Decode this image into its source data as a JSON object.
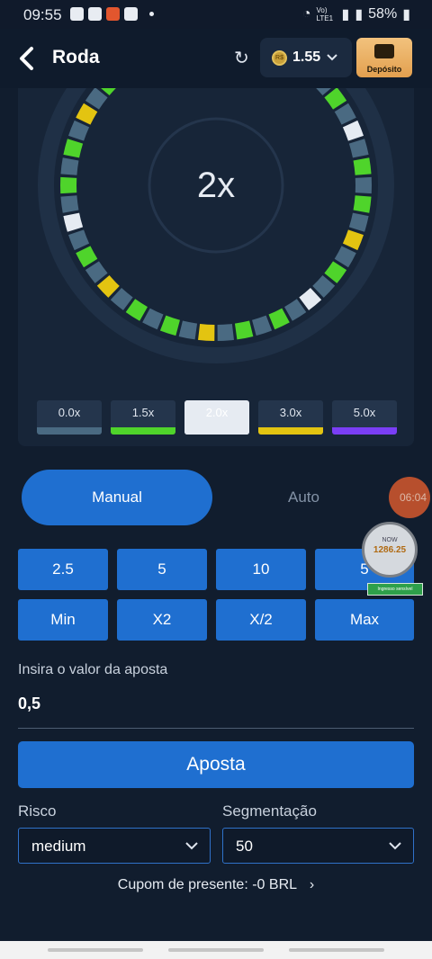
{
  "status_bar": {
    "time": "09:55",
    "battery": "58%",
    "network": "Vo) LTE1"
  },
  "header": {
    "title": "Roda",
    "balance": "1.55",
    "coin_symbol": "R$",
    "deposit_label": "Depósito"
  },
  "wheel": {
    "multiplier": "2x",
    "legend": [
      {
        "label": "0.0x",
        "color": "#4a6a82"
      },
      {
        "label": "1.5x",
        "color": "#4fd42b"
      },
      {
        "label": "2.0x",
        "color": "#e6ebf2"
      },
      {
        "label": "3.0x",
        "color": "#e3c411"
      },
      {
        "label": "5.0x",
        "color": "#7a3ef5"
      }
    ],
    "selected_legend": "2.0x"
  },
  "mode_tabs": {
    "manual": "Manual",
    "auto": "Auto",
    "active": "Manual"
  },
  "overlay": {
    "timer": "06:04",
    "widget_label": "NOW",
    "widget_value": "1286.25",
    "widget_bar": "Ingresso sensível"
  },
  "quick_bets": [
    "2.5",
    "5",
    "10",
    "5"
  ],
  "bet_modifiers": [
    "Min",
    "X2",
    "X/2",
    "Max"
  ],
  "bet_input": {
    "label": "Insira o valor da aposta",
    "value": "0,5"
  },
  "bet_button": "Aposta",
  "risk": {
    "label": "Risco",
    "value": "medium"
  },
  "segments": {
    "label": "Segmentação",
    "value": "50"
  },
  "coupon": "Cupom de presente: -0 BRL",
  "colors": {
    "accent": "#1f6fd0",
    "background": "#111d2e",
    "panel": "#172538"
  }
}
